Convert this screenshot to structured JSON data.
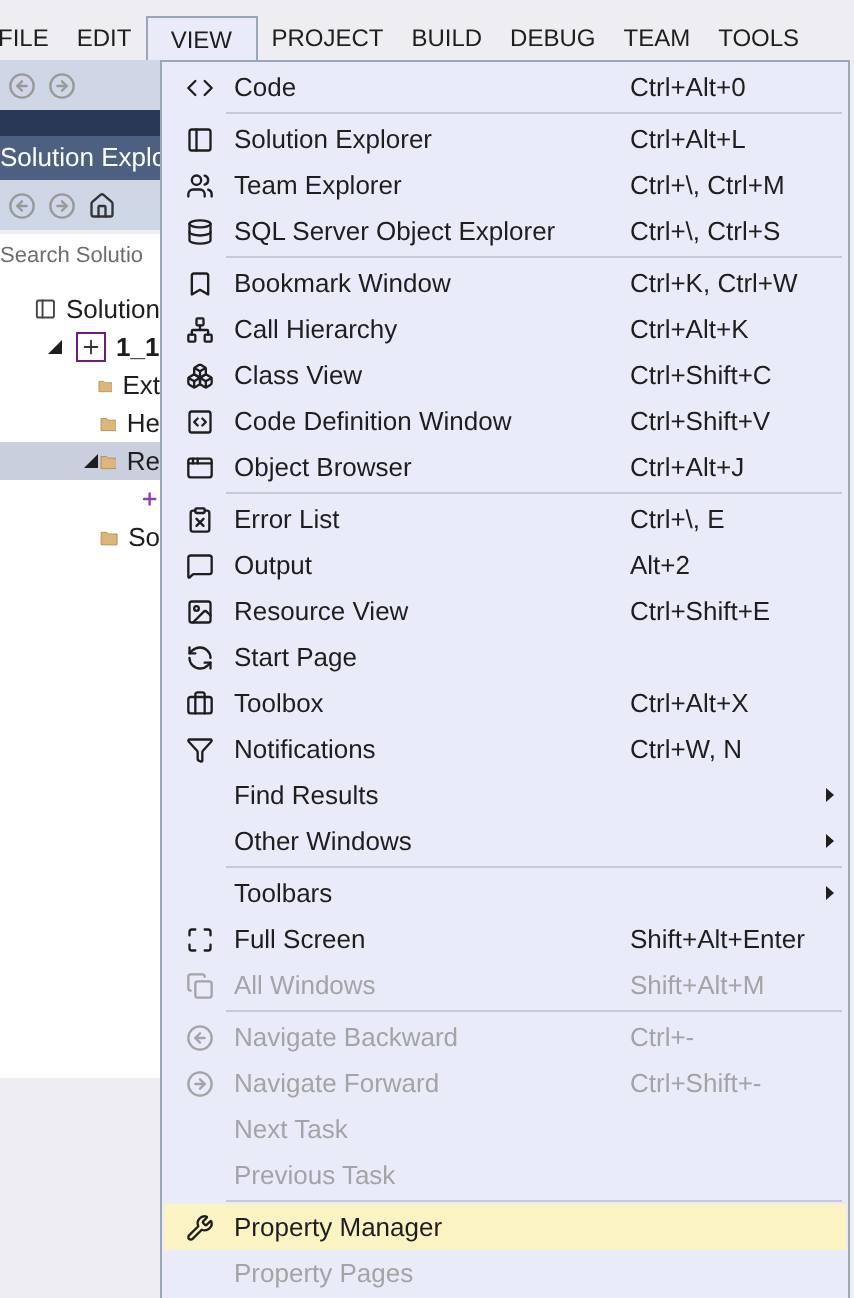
{
  "menu_bar": [
    {
      "label": "FILE",
      "selected": false
    },
    {
      "label": "EDIT",
      "selected": false
    },
    {
      "label": "VIEW",
      "selected": true
    },
    {
      "label": "PROJECT",
      "selected": false
    },
    {
      "label": "BUILD",
      "selected": false
    },
    {
      "label": "DEBUG",
      "selected": false
    },
    {
      "label": "TEAM",
      "selected": false
    },
    {
      "label": "TOOLS",
      "selected": false
    }
  ],
  "solution_explorer": {
    "title": "Solution Explo",
    "search": {
      "placeholder": "Search Solutio"
    },
    "tree": [
      {
        "kind": "solution",
        "label": "Solution",
        "expanded": false,
        "selected": false,
        "children": [
          {
            "kind": "project",
            "label": "1_1",
            "expanded": true,
            "selected": false,
            "children": [
              {
                "kind": "folder",
                "label": "Ext",
                "expanded": false,
                "selected": false
              },
              {
                "kind": "folder",
                "label": "He",
                "expanded": false,
                "selected": false
              },
              {
                "kind": "folder",
                "label": "Re",
                "expanded": true,
                "selected": true,
                "children": [
                  {
                    "kind": "file",
                    "expanded": false,
                    "selected": false
                  }
                ]
              },
              {
                "kind": "folder",
                "label": "So",
                "expanded": false,
                "selected": false
              }
            ]
          }
        ]
      }
    ]
  },
  "view_menu": {
    "groups": [
      [
        {
          "label": "Code",
          "shortcut": "Ctrl+Alt+0",
          "disabled": false,
          "selected": false,
          "submenu": false
        }
      ],
      [
        {
          "label": "Solution Explorer",
          "shortcut": "Ctrl+Alt+L",
          "disabled": false,
          "selected": false,
          "submenu": false
        },
        {
          "label": "Team Explorer",
          "shortcut": "Ctrl+\\, Ctrl+M",
          "disabled": false,
          "selected": false,
          "submenu": false
        },
        {
          "label": "SQL Server Object Explorer",
          "shortcut": "Ctrl+\\, Ctrl+S",
          "disabled": false,
          "selected": false,
          "submenu": false
        }
      ],
      [
        {
          "label": "Bookmark Window",
          "shortcut": "Ctrl+K, Ctrl+W",
          "disabled": false,
          "selected": false,
          "submenu": false
        },
        {
          "label": "Call Hierarchy",
          "shortcut": "Ctrl+Alt+K",
          "disabled": false,
          "selected": false,
          "submenu": false
        },
        {
          "label": "Class View",
          "shortcut": "Ctrl+Shift+C",
          "disabled": false,
          "selected": false,
          "submenu": false
        },
        {
          "label": "Code Definition Window",
          "shortcut": "Ctrl+Shift+V",
          "disabled": false,
          "selected": false,
          "submenu": false
        },
        {
          "label": "Object Browser",
          "shortcut": "Ctrl+Alt+J",
          "disabled": false,
          "selected": false,
          "submenu": false
        }
      ],
      [
        {
          "label": "Error List",
          "shortcut": "Ctrl+\\, E",
          "disabled": false,
          "selected": false,
          "submenu": false
        },
        {
          "label": "Output",
          "shortcut": "Alt+2",
          "disabled": false,
          "selected": false,
          "submenu": false
        },
        {
          "label": "Resource View",
          "shortcut": "Ctrl+Shift+E",
          "disabled": false,
          "selected": false,
          "submenu": false
        },
        {
          "label": "Start Page",
          "disabled": false,
          "selected": false,
          "submenu": false
        },
        {
          "label": "Toolbox",
          "shortcut": "Ctrl+Alt+X",
          "disabled": false,
          "selected": false,
          "submenu": false
        },
        {
          "label": "Notifications",
          "shortcut": "Ctrl+W, N",
          "disabled": false,
          "selected": false,
          "submenu": false
        },
        {
          "label": "Find Results",
          "disabled": false,
          "selected": false,
          "submenu": true
        },
        {
          "label": "Other Windows",
          "disabled": false,
          "selected": false,
          "submenu": true
        }
      ],
      [
        {
          "label": "Toolbars",
          "disabled": false,
          "selected": false,
          "submenu": true
        },
        {
          "label": "Full Screen",
          "shortcut": "Shift+Alt+Enter",
          "disabled": false,
          "selected": false,
          "submenu": false
        },
        {
          "label": "All Windows",
          "shortcut": "Shift+Alt+M",
          "disabled": true,
          "selected": false,
          "submenu": false
        }
      ],
      [
        {
          "label": "Navigate Backward",
          "shortcut": "Ctrl+-",
          "disabled": true,
          "selected": false,
          "submenu": false
        },
        {
          "label": "Navigate Forward",
          "shortcut": "Ctrl+Shift+-",
          "disabled": true,
          "selected": false,
          "submenu": false
        },
        {
          "label": "Next Task",
          "disabled": true,
          "selected": false,
          "submenu": false
        },
        {
          "label": "Previous Task",
          "disabled": true,
          "selected": false,
          "submenu": false
        }
      ],
      [
        {
          "label": "Property Manager",
          "disabled": false,
          "selected": true,
          "submenu": false
        },
        {
          "label": "Property Pages",
          "disabled": true,
          "selected": false,
          "submenu": false
        }
      ]
    ]
  }
}
